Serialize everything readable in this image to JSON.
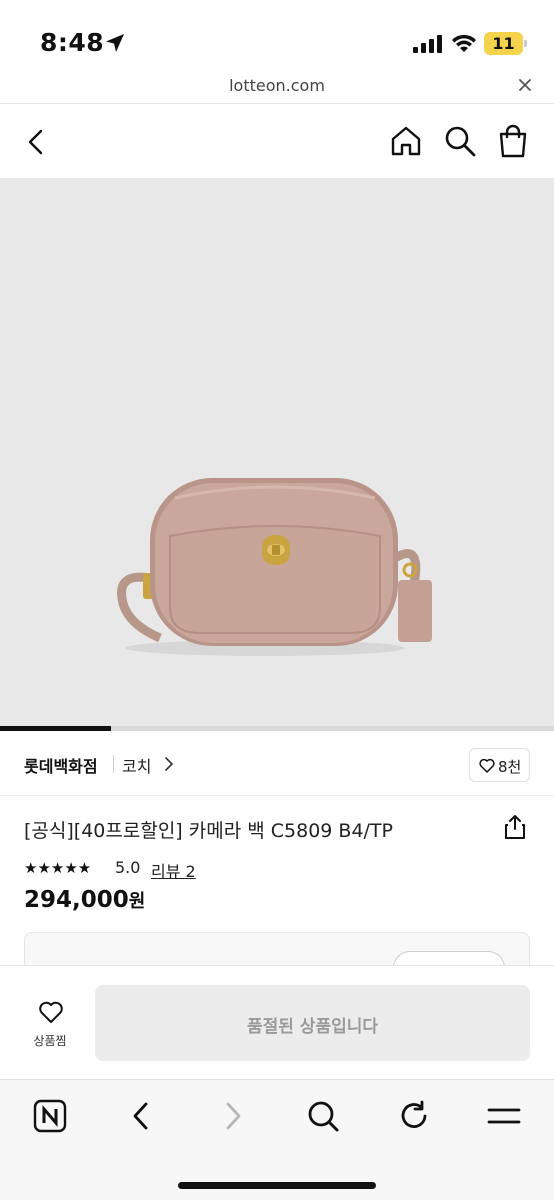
{
  "status_bar": {
    "time": "8:48",
    "battery": "11"
  },
  "browser": {
    "url": "lotteon.com"
  },
  "product_image": {
    "gallery_progress": 0.2
  },
  "brand_row": {
    "store": "롯데백화점",
    "brand": "코치",
    "likes": "8천"
  },
  "product": {
    "title": "[공식][40프로할인] 카메라 백 C5809 B4/TP",
    "stars": "★★★★★",
    "rating": "5.0",
    "review_link": "리뷰 2",
    "price": "294,000",
    "price_unit": "원"
  },
  "action_bar": {
    "wishlist_label": "상품찜",
    "soldout_label": "품절된 상품입니다"
  },
  "colors": {
    "brand_red": "#e0261b",
    "battery_yellow": "#f3d44c",
    "bag_tan": "#c9a79c"
  }
}
